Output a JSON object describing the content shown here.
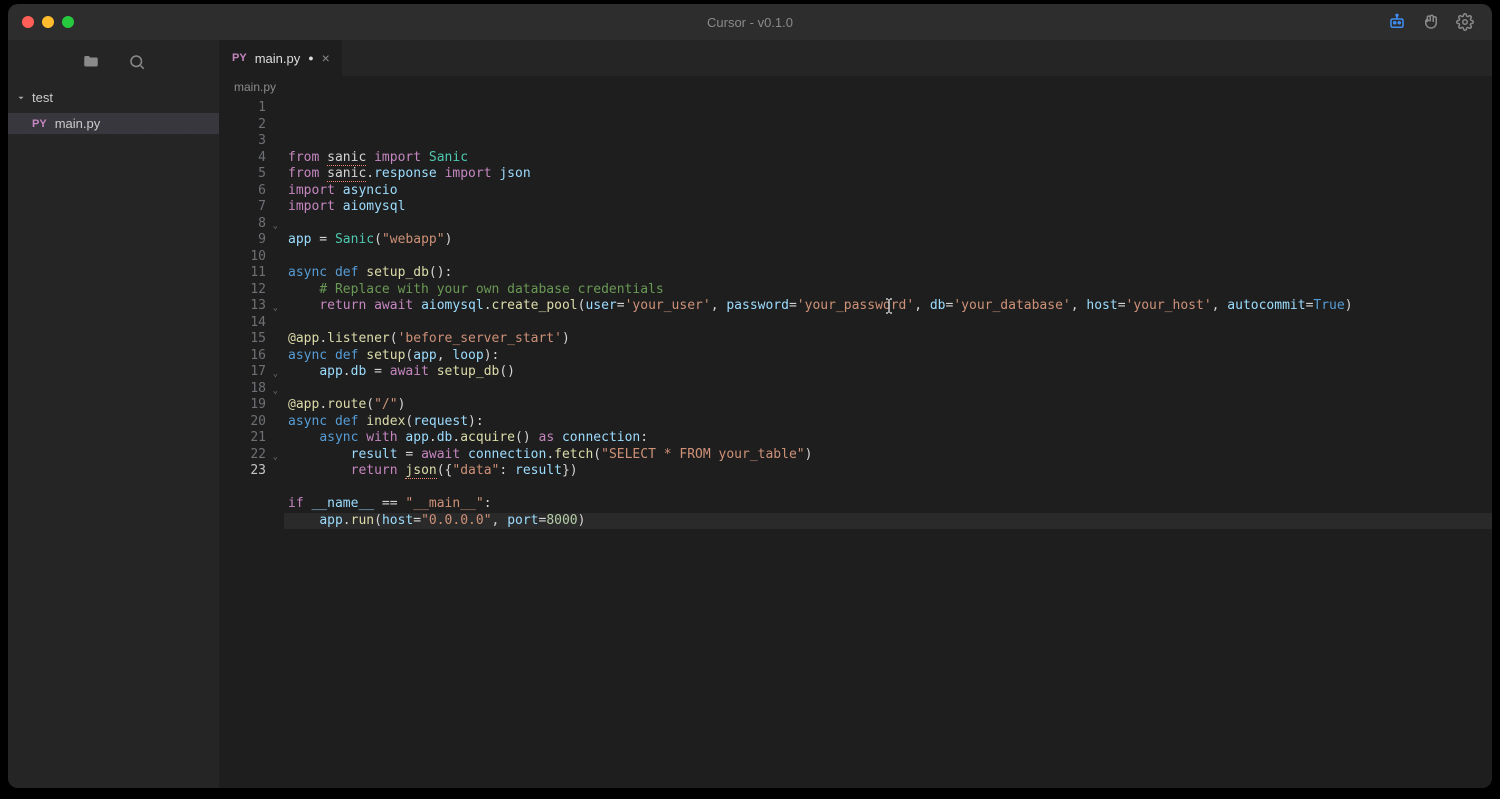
{
  "window": {
    "title": "Cursor - v0.1.0"
  },
  "sidebar": {
    "folder_name": "test",
    "items": [
      {
        "lang_badge": "PY",
        "name": "main.py",
        "active": true
      }
    ]
  },
  "tab": {
    "lang_badge": "PY",
    "filename": "main.py",
    "dirty_indicator": "●"
  },
  "breadcrumb": "main.py",
  "gutter": {
    "line_count": 23,
    "current_line": 23,
    "fold_lines": [
      8,
      13,
      17,
      18,
      22
    ]
  },
  "code_lines": [
    {
      "n": 1,
      "html": "<span class='kw'>from</span> <span class='err'>sanic</span> <span class='kw'>import</span> <span class='cls'>Sanic</span>"
    },
    {
      "n": 2,
      "html": "<span class='kw'>from</span> <span class='err'>sanic</span>.<span class='var'>response</span> <span class='kw'>import</span> <span class='var'>json</span>"
    },
    {
      "n": 3,
      "html": "<span class='kw'>import</span> <span class='var'>asyncio</span>"
    },
    {
      "n": 4,
      "html": "<span class='kw'>import</span> <span class='var'>aiomysql</span>"
    },
    {
      "n": 5,
      "html": ""
    },
    {
      "n": 6,
      "html": "<span class='var'>app</span> = <span class='cls'>Sanic</span>(<span class='str'>\"webapp\"</span>)"
    },
    {
      "n": 7,
      "html": ""
    },
    {
      "n": 8,
      "html": "<span class='kw2'>async</span> <span class='kw2'>def</span> <span class='fn'>setup_db</span>():"
    },
    {
      "n": 9,
      "html": "    <span class='cmt'># Replace with your own database credentials</span>"
    },
    {
      "n": 10,
      "html": "    <span class='kw'>return</span> <span class='kw'>await</span> <span class='var'>aiomysql</span>.<span class='fn'>create_pool</span>(<span class='var'>user</span>=<span class='str'>'your_user'</span>, <span class='var'>password</span>=<span class='str'>'your_password'</span>, <span class='var'>db</span>=<span class='str'>'your_database'</span>, <span class='var'>host</span>=<span class='str'>'your_host'</span>, <span class='var'>autocommit</span>=<span class='bool'>True</span>)"
    },
    {
      "n": 11,
      "html": ""
    },
    {
      "n": 12,
      "html": "<span class='dec'>@app</span>.<span class='fn'>listener</span>(<span class='str'>'before_server_start'</span>)"
    },
    {
      "n": 13,
      "html": "<span class='kw2'>async</span> <span class='kw2'>def</span> <span class='fn'>setup</span>(<span class='var'>app</span>, <span class='var'>loop</span>):"
    },
    {
      "n": 14,
      "html": "    <span class='var'>app</span>.<span class='var'>db</span> = <span class='kw'>await</span> <span class='fn'>setup_db</span>()"
    },
    {
      "n": 15,
      "html": ""
    },
    {
      "n": 16,
      "html": "<span class='dec'>@app</span>.<span class='fn'>route</span>(<span class='str'>\"/\"</span>)"
    },
    {
      "n": 17,
      "html": "<span class='kw2'>async</span> <span class='kw2'>def</span> <span class='fn'>index</span>(<span class='var'>request</span>):"
    },
    {
      "n": 18,
      "html": "    <span class='kw2'>async</span> <span class='kw'>with</span> <span class='var'>app</span>.<span class='var'>db</span>.<span class='fn'>acquire</span>() <span class='kw'>as</span> <span class='var'>connection</span>:"
    },
    {
      "n": 19,
      "html": "        <span class='var'>result</span> = <span class='kw'>await</span> <span class='var'>connection</span>.<span class='fn'>fetch</span>(<span class='str'>\"SELECT * FROM your_table\"</span>)"
    },
    {
      "n": 20,
      "html": "        <span class='kw'>return</span> <span class='fn err'>json</span>({<span class='str'>\"data\"</span>: <span class='var'>result</span>})"
    },
    {
      "n": 21,
      "html": ""
    },
    {
      "n": 22,
      "html": "<span class='kw'>if</span> <span class='var'>__name__</span> == <span class='str'>\"__main__\"</span>:"
    },
    {
      "n": 23,
      "html": "    <span class='var'>app</span>.<span class='fn'>run</span>(<span class='var'>host</span>=<span class='str'>\"0.0.0.0\"</span>, <span class='var'>port</span>=<span class='num'>8000</span>)"
    }
  ]
}
